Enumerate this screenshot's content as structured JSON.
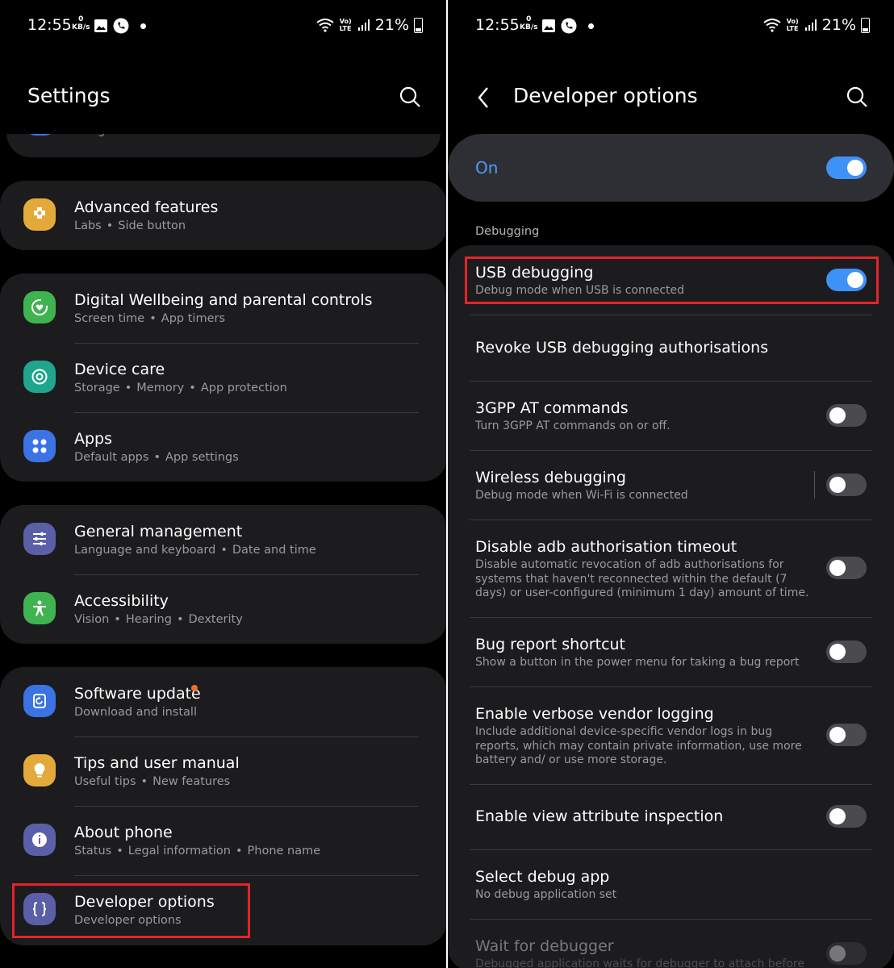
{
  "status_bar": {
    "time": "12:55",
    "net_speed_value": "0",
    "net_speed_unit": "KB/s",
    "lte_label": "Vo) LTE",
    "battery": "21%"
  },
  "settings": {
    "title": "Settings",
    "partial_item": "Google services",
    "advanced": {
      "title": "Advanced features",
      "sub": [
        "Labs",
        "Side button"
      ]
    },
    "wellbeing": {
      "title": "Digital Wellbeing and parental controls",
      "sub": [
        "Screen time",
        "App timers"
      ]
    },
    "device_care": {
      "title": "Device care",
      "sub": [
        "Storage",
        "Memory",
        "App protection"
      ]
    },
    "apps": {
      "title": "Apps",
      "sub": [
        "Default apps",
        "App settings"
      ]
    },
    "general": {
      "title": "General management",
      "sub": [
        "Language and keyboard",
        "Date and time"
      ]
    },
    "accessibility": {
      "title": "Accessibility",
      "sub": [
        "Vision",
        "Hearing",
        "Dexterity"
      ]
    },
    "software_update": {
      "title": "Software update",
      "sub": [
        "Download and install"
      ]
    },
    "tips": {
      "title": "Tips and user manual",
      "sub": [
        "Useful tips",
        "New features"
      ]
    },
    "about": {
      "title": "About phone",
      "sub": [
        "Status",
        "Legal information",
        "Phone name"
      ]
    },
    "developer": {
      "title": "Developer options",
      "sub": [
        "Developer options"
      ]
    }
  },
  "developer": {
    "title": "Developer options",
    "master": {
      "label": "On",
      "on": true
    },
    "section": "Debugging",
    "items": {
      "usb": {
        "title": "USB debugging",
        "sub": "Debug mode when USB is connected",
        "on": true
      },
      "revoke": {
        "title": "Revoke USB debugging authorisations"
      },
      "gpp": {
        "title": "3GPP AT commands",
        "sub": "Turn 3GPP AT commands on or off.",
        "on": false
      },
      "wireless": {
        "title": "Wireless debugging",
        "sub": "Debug mode when Wi-Fi is connected",
        "on": false
      },
      "adb_timeout": {
        "title": "Disable adb authorisation timeout",
        "sub": "Disable automatic revocation of adb authorisations for systems that haven't reconnected within the default (7 days) or user-configured (minimum 1 day) amount of time.",
        "on": false
      },
      "bugreport": {
        "title": "Bug report shortcut",
        "sub": "Show a button in the power menu for taking a bug report",
        "on": false
      },
      "verbose": {
        "title": "Enable verbose vendor logging",
        "sub": "Include additional device-specific vendor logs in bug reports, which may contain private information, use more battery and/ or use more storage.",
        "on": false
      },
      "view_attr": {
        "title": "Enable view attribute inspection",
        "on": false
      },
      "debug_app": {
        "title": "Select debug app",
        "sub": "No debug application set"
      },
      "wait_debugger": {
        "title": "Wait for debugger",
        "sub": "Debugged application waits for debugger to attach before",
        "on": false
      }
    }
  },
  "colors": {
    "accent": "#3e91f5",
    "highlight": "#e3242b",
    "card": "#1c1c1f",
    "badge": "#f36b2b"
  }
}
